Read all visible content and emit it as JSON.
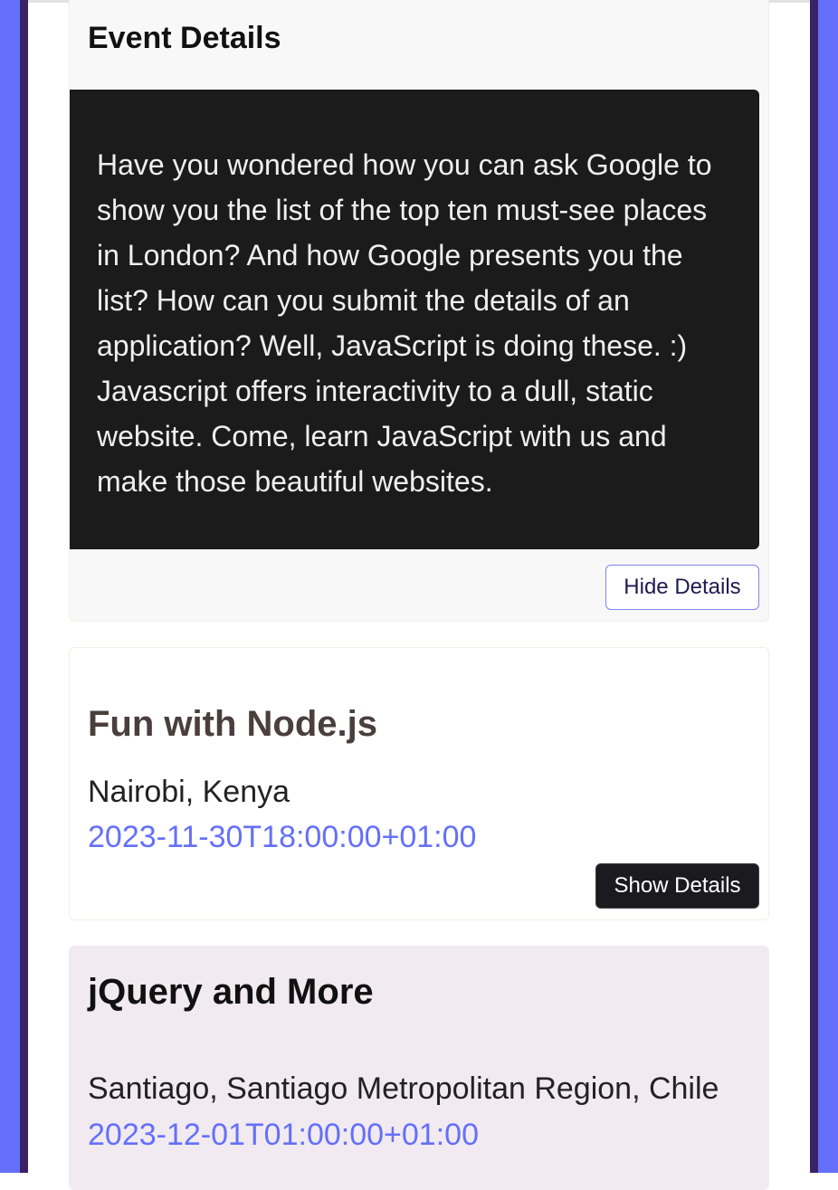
{
  "colors": {
    "accent": "#6470f9",
    "frame_dark": "#3a2266",
    "details_background": "#1b1b1b",
    "date_text": "#6470f9"
  },
  "expanded_event": {
    "heading": "Event Details",
    "description": "Have you wondered how you can ask Google to show you the list of the top ten must-see places in London? And how Google presents you the list? How can you submit the details of an application? Well, JavaScript is doing these. :) Javascript offers interactivity to a dull, static website. Come, learn JavaScript with us and make those beautiful websites.",
    "hide_button_label": "Hide Details"
  },
  "events": [
    {
      "title": "Fun with Node.js",
      "location": "Nairobi, Kenya",
      "date": "2023-11-30T18:00:00+01:00",
      "show_button_label": "Show Details"
    },
    {
      "title": "jQuery and More",
      "location": "Santiago, Santiago Metropolitan Region, Chile",
      "date": "2023-12-01T01:00:00+01:00"
    }
  ]
}
